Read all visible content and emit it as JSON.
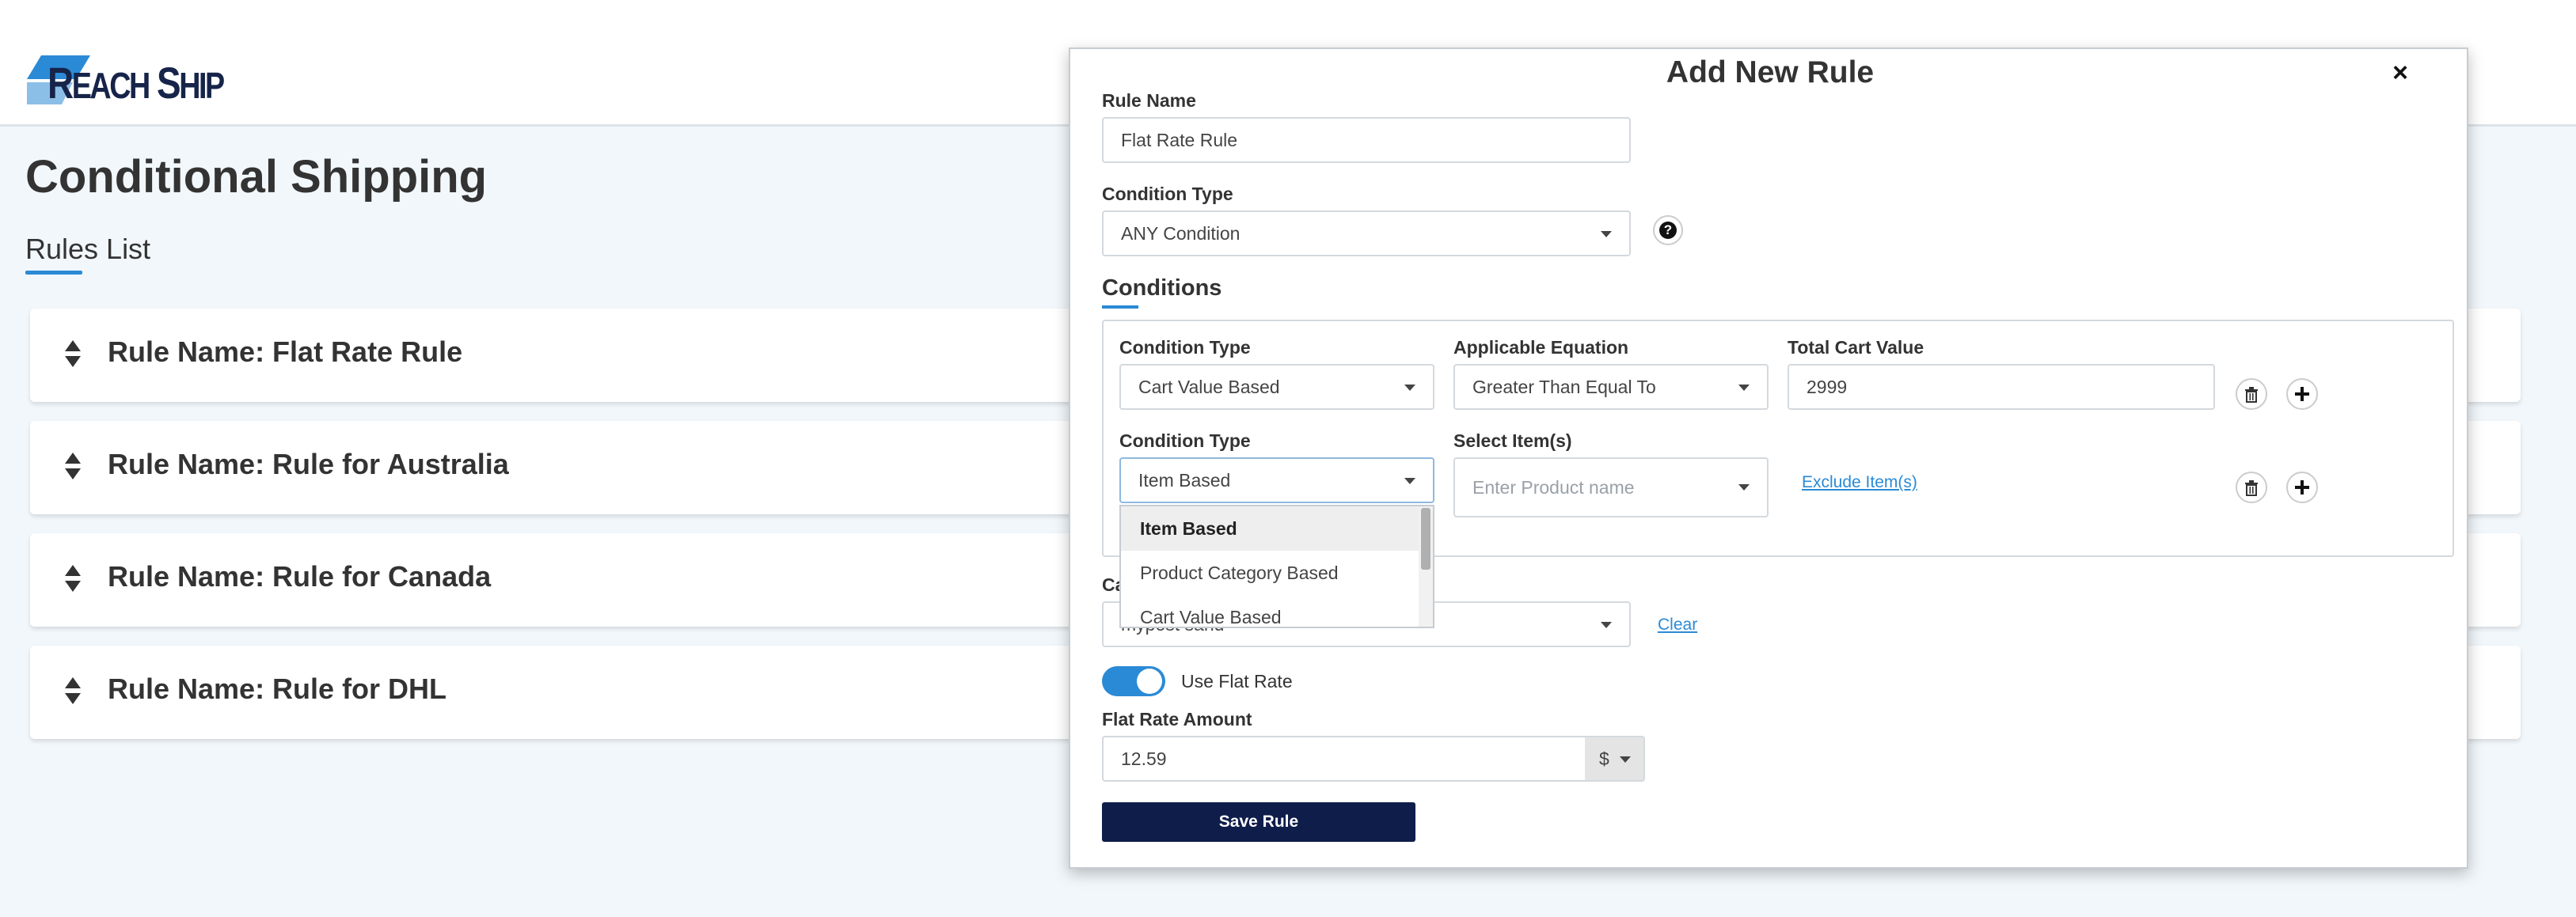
{
  "brand": {
    "logo_text_big": "R",
    "logo_text_small_1": "EACH",
    "logo_text_big_2": "S",
    "logo_text_small_2": "HIP",
    "accent_color": "#2b8ad6",
    "navy_color": "#0f1d4a"
  },
  "page": {
    "title": "Conditional Shipping",
    "tab_label": "Rules List"
  },
  "rules": [
    {
      "title": "Rule Name: Flat Rate Rule"
    },
    {
      "title": "Rule Name: Rule for Australia"
    },
    {
      "title": "Rule Name: Rule for Canada"
    },
    {
      "title": "Rule Name: Rule for DHL"
    }
  ],
  "modal": {
    "title": "Add New Rule",
    "close_label": "×",
    "rule_name_label": "Rule Name",
    "rule_name_value": "Flat Rate Rule",
    "condition_type_label": "Condition Type",
    "condition_type_value": "ANY Condition",
    "help_label": "?",
    "conditions_title": "Conditions",
    "conditions": [
      {
        "type_label": "Condition Type",
        "type_value": "Cart Value Based",
        "equation_label": "Applicable Equation",
        "equation_value": "Greater Than Equal To",
        "value_label": "Total Cart Value",
        "value_value": "2999"
      },
      {
        "type_label": "Condition Type",
        "type_value": "Item Based",
        "items_label": "Select Item(s)",
        "items_placeholder": "Enter Product name",
        "exclude_link": "Exclude Item(s)"
      }
    ],
    "dropdown_options": [
      "Item Based",
      "Product Category Based",
      "Cart Value Based"
    ],
    "carrier_label_partial": "Ca",
    "carrier_value_partial": "mypost sand",
    "clear_link": "Clear",
    "use_flat_rate_label": "Use Flat Rate",
    "use_flat_rate_on": true,
    "flat_rate_label": "Flat Rate Amount",
    "flat_rate_value": "12.59",
    "currency": "$",
    "save_label": "Save Rule"
  }
}
